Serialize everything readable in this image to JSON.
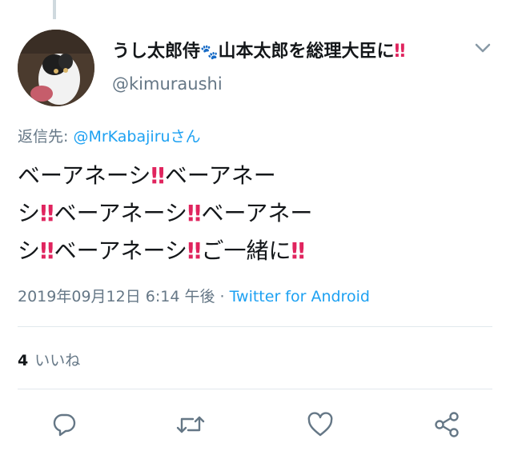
{
  "user": {
    "display_name_prefix": "うし太郎侍",
    "display_name_emoji": "🐾",
    "display_name_suffix": "山本太郎を総理大臣に",
    "display_name_end": "‼",
    "handle": "@kimuraushi"
  },
  "reply": {
    "label": "返信先: ",
    "target": "@MrKabajiru",
    "suffix": "さん"
  },
  "tweet": {
    "lines": [
      [
        "ベーアネーシ",
        "‼",
        "ベーアネー"
      ],
      [
        "シ",
        "‼",
        "ベーアネーシ",
        "‼",
        "ベーアネー"
      ],
      [
        "シ",
        "‼",
        "ベーアネーシ",
        "‼",
        "ご一緒に",
        "‼"
      ]
    ]
  },
  "meta": {
    "timestamp": "2019年09月12日 6:14 午後",
    "separator": " · ",
    "source": "Twitter for Android"
  },
  "stats": {
    "likes_count": "4",
    "likes_label": "いいね"
  },
  "actions": {
    "icons": [
      "reply-icon",
      "retweet-icon",
      "like-icon",
      "share-icon"
    ]
  },
  "colors": {
    "accent": "#1da1f2",
    "muted": "#657786",
    "exclaim": "#e0245e"
  }
}
